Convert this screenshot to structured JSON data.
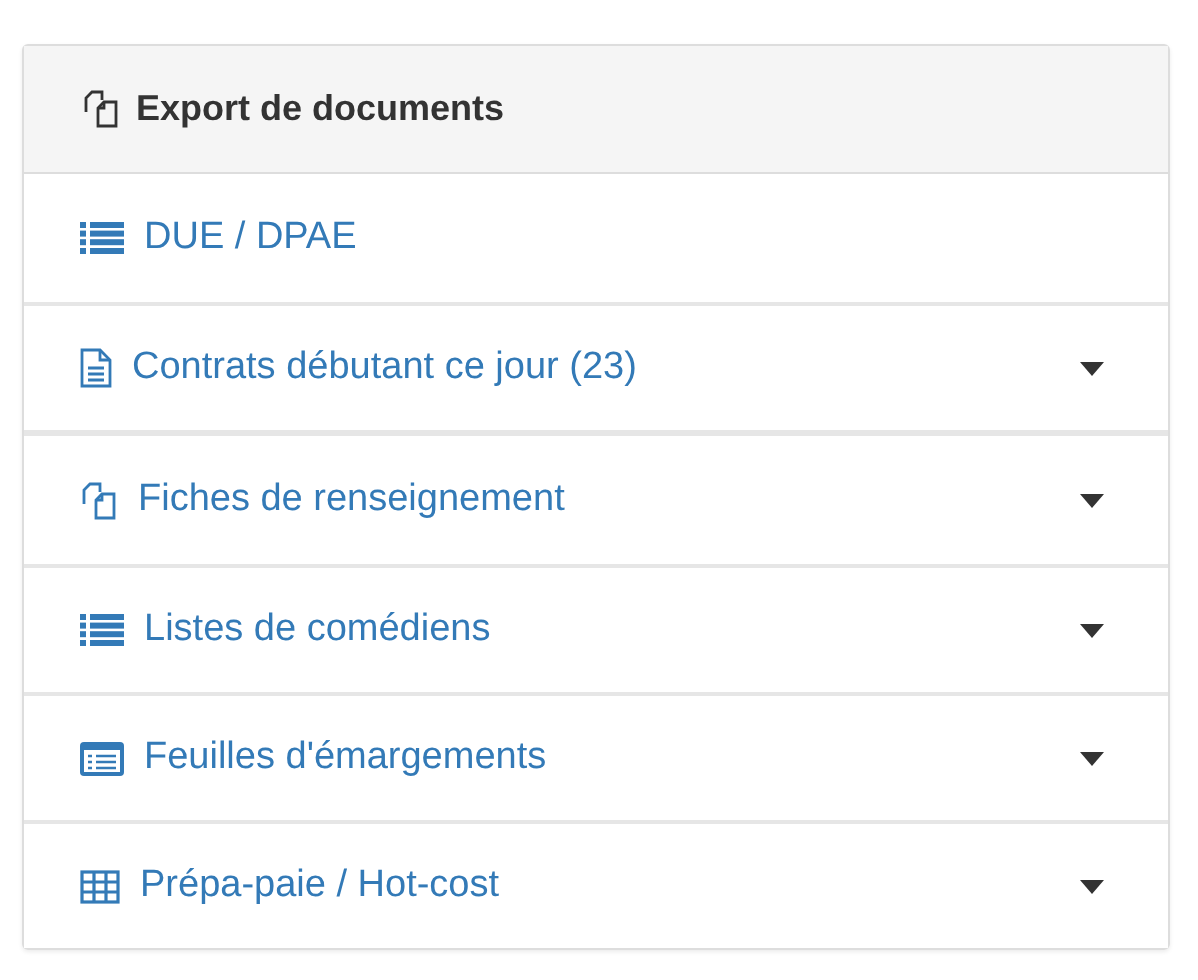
{
  "panel": {
    "title": "Export de documents",
    "kind": "copy"
  },
  "groups": [
    {
      "items": [
        {
          "label": "DUE / DPAE",
          "kind": "list",
          "dropdown": false
        },
        {
          "label": "Contrats débutant ce jour (23)",
          "kind": "file",
          "dropdown": true
        }
      ]
    },
    {
      "items": [
        {
          "label": "Fiches de renseignement",
          "kind": "copy",
          "dropdown": true
        },
        {
          "label": "Listes de comédiens",
          "kind": "list",
          "dropdown": true
        },
        {
          "label": "Feuilles d'émargements",
          "kind": "card",
          "dropdown": true
        },
        {
          "label": "Prépa-paie / Hot-cost",
          "kind": "table",
          "dropdown": true
        }
      ]
    }
  ]
}
